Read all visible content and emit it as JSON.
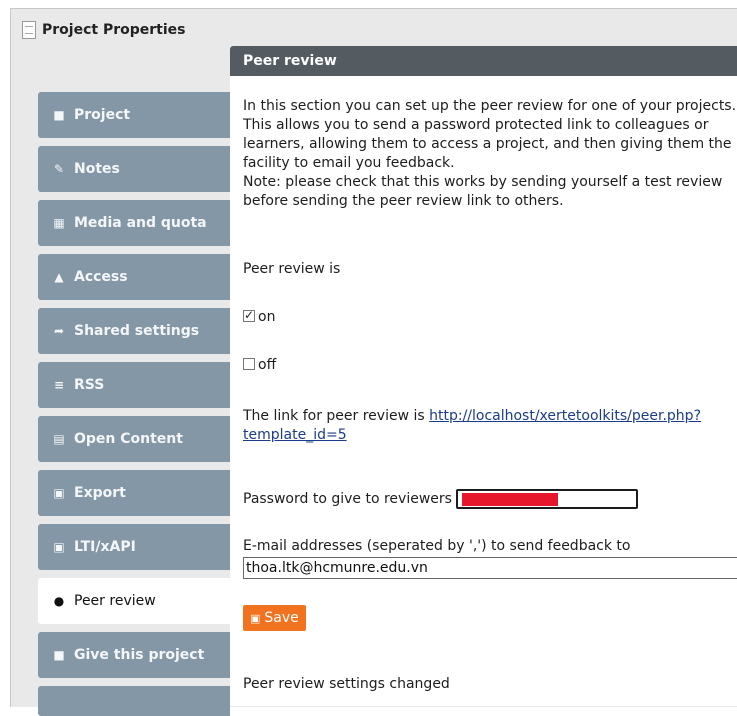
{
  "window": {
    "title": "Project Properties"
  },
  "sidebar": {
    "items": [
      {
        "label": "Project",
        "icon": "file-icon",
        "glyph": "■"
      },
      {
        "label": "Notes",
        "icon": "edit-icon",
        "glyph": "✎"
      },
      {
        "label": "Media and quota",
        "icon": "film-icon",
        "glyph": "▦"
      },
      {
        "label": "Access",
        "icon": "unlock-icon",
        "glyph": "▲"
      },
      {
        "label": "Shared settings",
        "icon": "share-icon",
        "glyph": "➦"
      },
      {
        "label": "RSS",
        "icon": "rss-icon",
        "glyph": "≡"
      },
      {
        "label": "Open Content",
        "icon": "cc-icon",
        "glyph": "▤"
      },
      {
        "label": "Export",
        "icon": "save-icon",
        "glyph": "▣"
      },
      {
        "label": "LTI/xAPI",
        "icon": "lti-icon",
        "glyph": "▣"
      },
      {
        "label": "Peer review",
        "icon": "comments-icon",
        "glyph": "●",
        "active": true
      },
      {
        "label": "Give this project",
        "icon": "gift-icon",
        "glyph": "■"
      }
    ]
  },
  "panel": {
    "title": "Peer review",
    "intro": "In this section you can set up the peer review for one of your projects. This allows you to send a password protected link to colleagues or learners, allowing them to access a project, and then giving them the facility to email you feedback.",
    "note": "Note: please check that this works by sending yourself a test review before sending the peer review link to others.",
    "status_label": "Peer review is",
    "on_label": "on",
    "off_label": "off",
    "on_checked": true,
    "off_checked": false,
    "link_prefix": "The link for peer review is ",
    "link_url": "http://localhost/xertetoolkits/peer.php?template_id=5",
    "password_label": "Password to give to reviewers",
    "email_label": "E-mail addresses (seperated by ',') to send feedback to",
    "email_value": "thoa.ltk@hcmunre.edu.vn",
    "save_label": "Save",
    "status_message": "Peer review settings changed"
  },
  "colors": {
    "tab_bg": "#8397a6",
    "header_bg": "#545c61",
    "save_bg": "#f2731f",
    "redaction": "#e8162c"
  }
}
